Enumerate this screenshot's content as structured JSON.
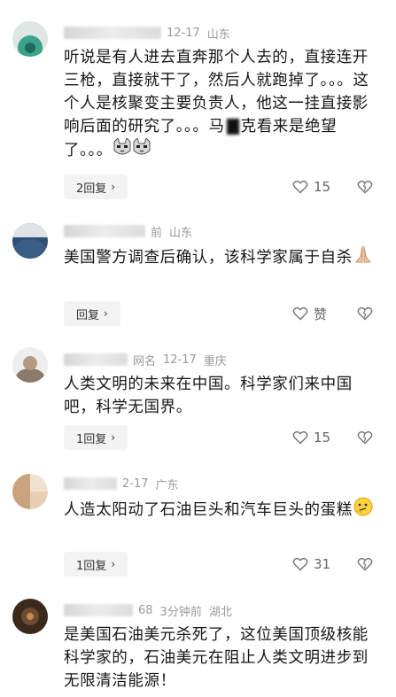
{
  "comments": [
    {
      "time": "12-17",
      "location": "山东",
      "text": "听说是有人进去直奔那个人去的，直接连开三枪，直接就干了，然后人就跑掉了。。。这个人是核聚变主要负责人，他这一挂直接影响后面的研究了。。。马",
      "text_tail": "克看来是绝望了。。。",
      "reply_label": "2回复",
      "likes": "15",
      "avatar_color": "#3aa38c"
    },
    {
      "time": "前",
      "location": "山东",
      "text": "美国警方调查后确认，该科学家属于自杀",
      "reply_label": "回复",
      "likes": "赞",
      "avatar_color": "#2f4f74"
    },
    {
      "name_partial": "网名",
      "time": "12-17",
      "location": "重庆",
      "text": "人类文明的未来在中国。科学家们来中国吧，科学无国界。",
      "reply_label": "1回复",
      "likes": "15",
      "avatar_color": "#8a7a6a"
    },
    {
      "time": "2-17",
      "location": "广东",
      "text": "人造太阳动了石油巨头和汽车巨头的蛋糕",
      "reply_label": "1回复",
      "likes": "31",
      "avatar_color": "#c9a27e"
    },
    {
      "name_partial": "68",
      "time": "3分钟前",
      "location": "湖北",
      "text": "是美国石油美元杀死了，这位美国顶级核能科学家的，石油美元在阻止人类文明进步到无限清洁能源！",
      "avatar_color": "#6b4c2f"
    }
  ],
  "icons": {
    "heart": "heart-outline-icon",
    "dislike": "broken-heart-icon",
    "chevron": "chevron-right-icon",
    "cat_emoji": "cat-face-emoji",
    "pray_emoji": "praying-hands-emoji",
    "think_emoji": "thinking-face-emoji"
  }
}
